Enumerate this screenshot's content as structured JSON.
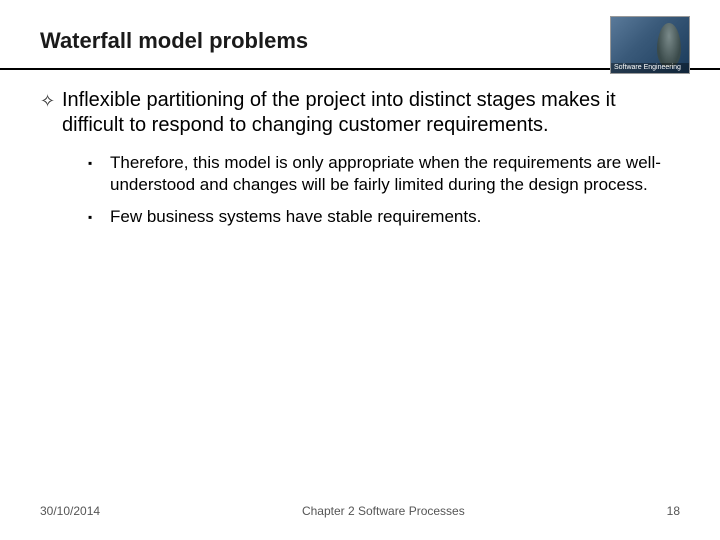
{
  "header": {
    "title": "Waterfall model problems",
    "corner_label": "Software Engineering"
  },
  "body": {
    "main_point": "Inflexible partitioning of the project into distinct stages makes it difficult to respond to changing customer requirements.",
    "sub_points": [
      "Therefore, this model is only appropriate when the requirements are well-understood and changes will be fairly limited during the design process.",
      "Few business systems have stable requirements."
    ]
  },
  "footer": {
    "date": "30/10/2014",
    "chapter": "Chapter 2 Software Processes",
    "page": "18"
  },
  "glyphs": {
    "diamond": "✧",
    "square": "▪"
  }
}
